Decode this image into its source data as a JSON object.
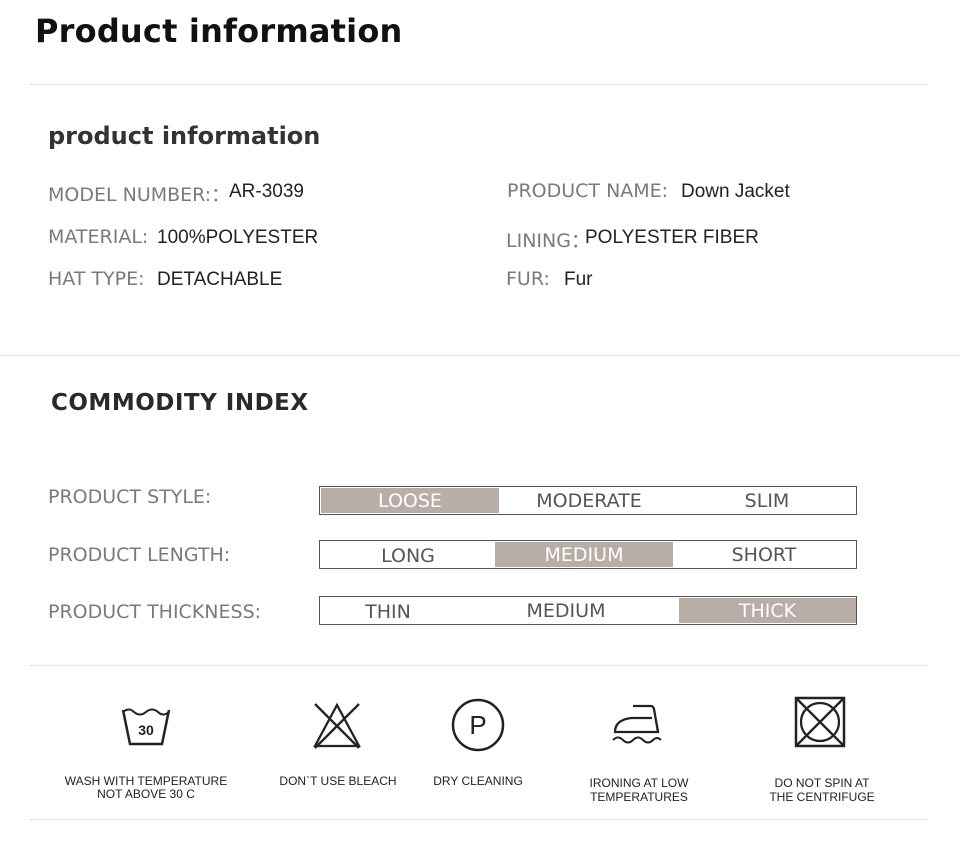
{
  "header": {
    "title": "Product information"
  },
  "info": {
    "heading": "product information",
    "rows": [
      {
        "label": "MODEL NUMBER:：",
        "value": "AR-3039"
      },
      {
        "label": "PRODUCT NAME:",
        "value": "Down Jacket"
      },
      {
        "label": "MATERIAL:",
        "value": "100%POLYESTER"
      },
      {
        "label": "LINING：",
        "value": "POLYESTER FIBER"
      },
      {
        "label": "HAT TYPE:",
        "value": "DETACHABLE"
      },
      {
        "label": "FUR:",
        "value": "Fur"
      }
    ]
  },
  "index": {
    "heading": "COMMODITY INDEX",
    "rows": [
      {
        "label": "PRODUCT STYLE:",
        "options": [
          "LOOSE",
          "MODERATE",
          "SLIM"
        ],
        "selected": "LOOSE"
      },
      {
        "label": "PRODUCT LENGTH:",
        "options": [
          "LONG",
          "MEDIUM",
          "SHORT"
        ],
        "selected": "MEDIUM"
      },
      {
        "label": "PRODUCT THICKNESS:",
        "options": [
          "THIN",
          "MEDIUM",
          "THICK"
        ],
        "selected": "THICK"
      }
    ],
    "highlight_color": "#b8aea7"
  },
  "care": [
    {
      "icon": "wash-30-icon",
      "icon_text": "30",
      "line1": "WASH WITH TEMPERATURE",
      "line2": "NOT ABOVE 30 C"
    },
    {
      "icon": "no-bleach-icon",
      "line1": "DON`T USE BLEACH",
      "line2": ""
    },
    {
      "icon": "dry-clean-icon",
      "icon_text": "P",
      "line1": "DRY CLEANING",
      "line2": ""
    },
    {
      "icon": "iron-low-icon",
      "line1": "IRONING AT LOW",
      "line2": "TEMPERATURES"
    },
    {
      "icon": "no-tumble-icon",
      "line1": "DO NOT SPIN AT",
      "line2": "THE CENTRIFUGE"
    }
  ]
}
